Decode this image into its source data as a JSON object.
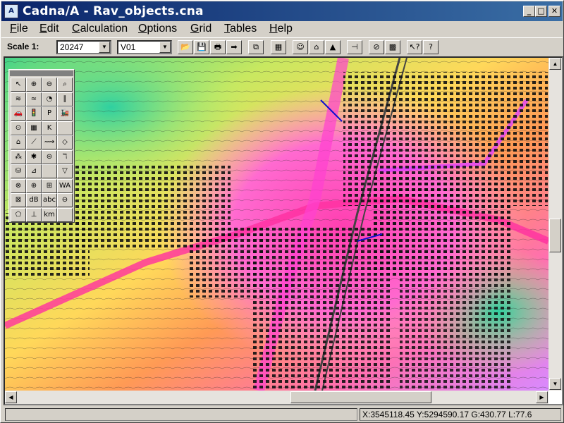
{
  "window": {
    "title": "Cadna/A - Rav_objects.cna",
    "icon_name": "cadna-app-icon",
    "icon_text": "A",
    "minimize_glyph": "_",
    "maximize_glyph": "□",
    "close_glyph": "✕"
  },
  "menu": {
    "items": [
      {
        "first": "F",
        "rest": "ile"
      },
      {
        "first": "E",
        "rest": "dit"
      },
      {
        "first": "C",
        "rest": "alculation"
      },
      {
        "first": "O",
        "rest": "ptions"
      },
      {
        "first": "G",
        "rest": "rid"
      },
      {
        "first": "T",
        "rest": "ables"
      },
      {
        "first": "H",
        "rest": "elp"
      }
    ]
  },
  "toolbar": {
    "scale_label": "Scale 1:",
    "scale_value": "20247",
    "variant_value": "V01",
    "dropdown_glyph": "▼",
    "buttons": [
      {
        "name": "open-icon",
        "glyph": "📂"
      },
      {
        "name": "save-icon",
        "glyph": "💾"
      },
      {
        "name": "print-icon",
        "glyph": "🖶"
      },
      {
        "name": "export-arrow-icon",
        "glyph": "➡"
      },
      {
        "name": "copy-icon",
        "glyph": "⧉"
      },
      {
        "name": "calculator-icon",
        "glyph": "▦"
      },
      {
        "name": "smiley-icon",
        "glyph": "☺"
      },
      {
        "name": "industry-icon",
        "glyph": "⌂"
      },
      {
        "name": "landscape-icon",
        "glyph": "▲"
      },
      {
        "name": "pin-icon",
        "glyph": "⊣"
      },
      {
        "name": "grid-settings-icon",
        "glyph": "⊘"
      },
      {
        "name": "grid-map-icon",
        "glyph": "▩"
      },
      {
        "name": "help-pointer-icon",
        "glyph": "↖?"
      },
      {
        "name": "help-icon",
        "glyph": "?"
      }
    ]
  },
  "palette": {
    "rows": [
      [
        {
          "name": "pointer-icon",
          "g": "↖"
        },
        {
          "name": "zoom-in-icon",
          "g": "⊕"
        },
        {
          "name": "zoom-out-icon",
          "g": "⊖"
        },
        {
          "name": "zoom-window-icon",
          "g": "⌕"
        }
      ],
      [
        {
          "name": "point-source-icon",
          "g": "≋"
        },
        {
          "name": "line-source-icon",
          "g": "≈"
        },
        {
          "name": "area-source-icon",
          "g": "◔"
        },
        {
          "name": "vertical-area-icon",
          "g": "∥"
        }
      ],
      [
        {
          "name": "road-icon",
          "g": "🚗"
        },
        {
          "name": "traffic-light-icon",
          "g": "🚦"
        },
        {
          "name": "parking-icon",
          "g": "P"
        },
        {
          "name": "railway-icon",
          "g": "🚂"
        }
      ],
      [
        {
          "name": "gauge-icon",
          "g": "⊙"
        },
        {
          "name": "building-icon",
          "g": "▦"
        },
        {
          "name": "text-k-icon",
          "g": "K"
        },
        {
          "name": "empty-slot",
          "g": ""
        }
      ],
      [
        {
          "name": "house-icon",
          "g": "⌂"
        },
        {
          "name": "barrier-icon",
          "g": "⟋"
        },
        {
          "name": "bridge-icon",
          "g": "⟿"
        },
        {
          "name": "cylinder-icon",
          "g": "◇"
        }
      ],
      [
        {
          "name": "trees-icon",
          "g": "⁂"
        },
        {
          "name": "vegetation-icon",
          "g": "✱"
        },
        {
          "name": "receiver-icon",
          "g": "⊜"
        },
        {
          "name": "wind-icon",
          "g": "ℸ"
        }
      ],
      [
        {
          "name": "database-icon",
          "g": "⛁"
        },
        {
          "name": "ruler-icon",
          "g": "⊿"
        },
        {
          "name": "blank-slot",
          "g": ""
        },
        {
          "name": "triangle-icon",
          "g": "▽"
        }
      ],
      [
        {
          "name": "globe-icon",
          "g": "⊗"
        },
        {
          "name": "grid-globe-icon",
          "g": "⊕"
        },
        {
          "name": "calc-area-icon",
          "g": "⊞"
        },
        {
          "name": "wa-label-icon",
          "g": "WA"
        }
      ],
      [
        {
          "name": "grid-tool-icon",
          "g": "⊠"
        },
        {
          "name": "db-label-icon",
          "g": "dB"
        },
        {
          "name": "abc-text-icon",
          "g": "abc"
        },
        {
          "name": "symbol-icon",
          "g": "⊖"
        }
      ],
      [
        {
          "name": "polygon-icon",
          "g": "⬠"
        },
        {
          "name": "height-point-icon",
          "g": "⊥"
        },
        {
          "name": "km-label-icon",
          "g": "km"
        },
        {
          "name": "empty-slot-2",
          "g": ""
        }
      ]
    ]
  },
  "scrollbars": {
    "up_glyph": "▲",
    "down_glyph": "▼",
    "left_glyph": "◀",
    "right_glyph": "▶"
  },
  "status": {
    "coordinates": "X:3545118.45 Y:5294590.17 G:430.77 L:77.6"
  },
  "colors": {
    "title_start": "#0a246a",
    "title_end": "#3a6ea5",
    "chrome": "#d4d0c8"
  }
}
